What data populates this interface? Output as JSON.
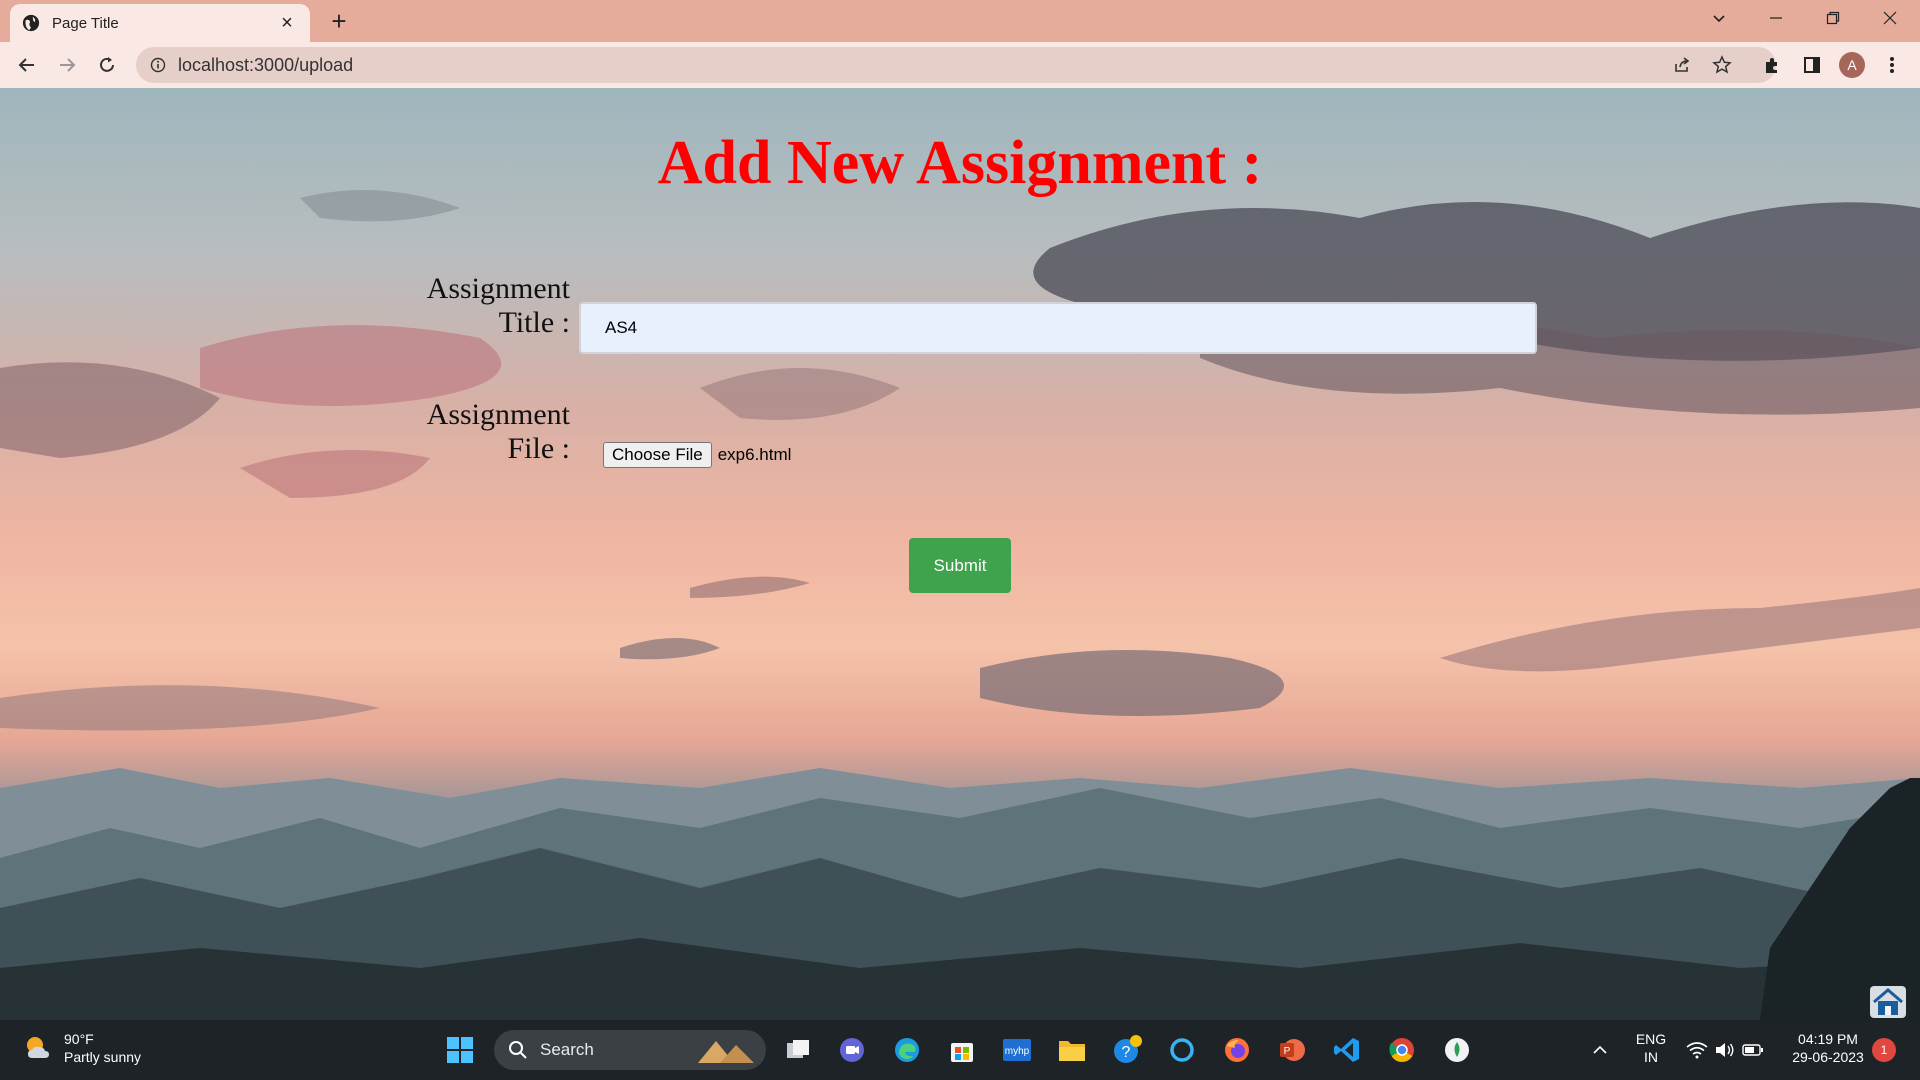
{
  "browser": {
    "tab_title": "Page Title",
    "url": "localhost:3000/upload",
    "profile_initial": "A"
  },
  "page": {
    "heading": "Add New Assignment :",
    "title_label_line1": "Assignment",
    "title_label_line2": "Title :",
    "title_value": "AS4",
    "file_label_line1": "Assignment",
    "file_label_line2": "File :",
    "choose_file_label": "Choose File",
    "file_name": "exp6.html",
    "submit_label": "Submit",
    "heading_color": "#ff0000",
    "submit_color": "#3fa34d"
  },
  "taskbar": {
    "weather_temp": "90°F",
    "weather_desc": "Partly sunny",
    "search_label": "Search",
    "lang_line1": "ENG",
    "lang_line2": "IN",
    "time": "04:19 PM",
    "date": "29-06-2023",
    "notification_count": "1"
  }
}
